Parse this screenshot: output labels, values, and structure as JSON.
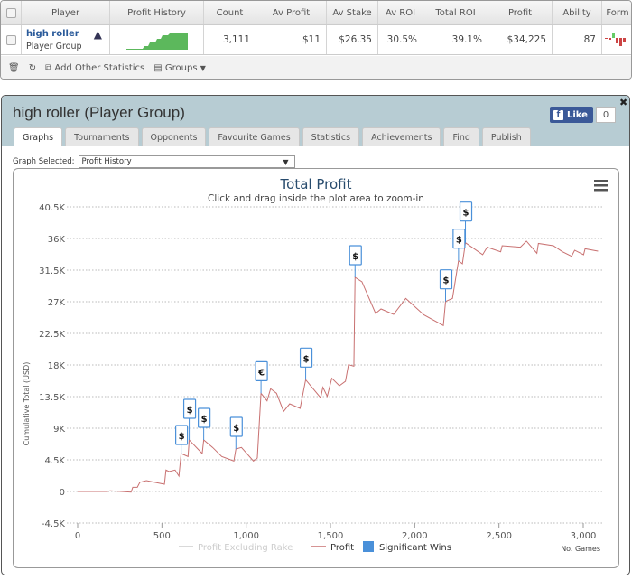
{
  "table": {
    "headers": [
      "Player",
      "Profit History",
      "Count",
      "Av Profit",
      "Av Stake",
      "Av ROI",
      "Total ROI",
      "Profit",
      "Ability",
      "Form"
    ],
    "row": {
      "player_name": "high roller",
      "player_type": "Player Group",
      "count": "3,111",
      "av_profit": "$11",
      "av_stake": "$26.35",
      "av_roi": "30.5%",
      "total_roi": "39.1%",
      "profit": "$34,225",
      "ability": "87"
    },
    "footer": {
      "add_stats": "Add Other Statistics",
      "groups": "Groups"
    }
  },
  "modal": {
    "title": "high roller (Player Group)",
    "like_label": "Like",
    "like_count": "0",
    "tabs": [
      "Graphs",
      "Tournaments",
      "Opponents",
      "Favourite Games",
      "Statistics",
      "Achievements",
      "Find",
      "Publish"
    ],
    "active_tab": "Graphs",
    "graph_selected_label": "Graph Selected:",
    "graph_selected_value": "Profit History"
  },
  "chart_data": {
    "type": "line",
    "title": "Total Profit",
    "subtitle": "Click and drag inside the plot area to zoom-in",
    "xlabel": "No. Games",
    "ylabel": "Cumulative Total (USD)",
    "xlim": [
      0,
      3120
    ],
    "ylim": [
      -4500,
      40500
    ],
    "xticks": [
      0,
      500,
      1000,
      1500,
      2000,
      2500,
      3000
    ],
    "xtick_labels": [
      "0",
      "500",
      "1,000",
      "1,500",
      "2,000",
      "2,500",
      "3,000"
    ],
    "yticks": [
      -4500,
      0,
      4500,
      9000,
      13500,
      18000,
      22500,
      27000,
      31500,
      36000,
      40500
    ],
    "ytick_labels": [
      "-4.5K",
      "0",
      "4.5K",
      "9K",
      "13.5K",
      "18K",
      "22.5K",
      "27K",
      "31.5K",
      "36K",
      "40.5K"
    ],
    "grid": true,
    "legend": [
      {
        "name": "Profit Excluding Rake",
        "color": "#cccccc"
      },
      {
        "name": "Profit",
        "color": "#c0504d"
      },
      {
        "name": "Significant Wins",
        "color": "#4a90d9"
      }
    ],
    "legend_placement": "bottom",
    "series": [
      {
        "name": "Profit",
        "color": "#c87070",
        "points": [
          [
            0,
            0
          ],
          [
            175,
            0
          ],
          [
            193,
            100
          ],
          [
            317,
            -100
          ],
          [
            327,
            600
          ],
          [
            354,
            600
          ],
          [
            369,
            1300
          ],
          [
            408,
            1540
          ],
          [
            515,
            1030
          ],
          [
            524,
            3050
          ],
          [
            542,
            2830
          ],
          [
            578,
            3050
          ],
          [
            601,
            2190
          ],
          [
            614,
            5400
          ],
          [
            655,
            4970
          ],
          [
            662,
            7330
          ],
          [
            739,
            5400
          ],
          [
            748,
            7330
          ],
          [
            801,
            6260
          ],
          [
            855,
            4970
          ],
          [
            927,
            4330
          ],
          [
            939,
            6040
          ],
          [
            972,
            6260
          ],
          [
            1043,
            4330
          ],
          [
            1066,
            4760
          ],
          [
            1088,
            13970
          ],
          [
            1124,
            12900
          ],
          [
            1145,
            14620
          ],
          [
            1180,
            13970
          ],
          [
            1222,
            11400
          ],
          [
            1258,
            12470
          ],
          [
            1320,
            11830
          ],
          [
            1353,
            15900
          ],
          [
            1442,
            13330
          ],
          [
            1455,
            14830
          ],
          [
            1481,
            13540
          ],
          [
            1508,
            16110
          ],
          [
            1553,
            15040
          ],
          [
            1589,
            15680
          ],
          [
            1607,
            18040
          ],
          [
            1639,
            17830
          ],
          [
            1646,
            30470
          ],
          [
            1687,
            29830
          ],
          [
            1768,
            25330
          ],
          [
            1800,
            25970
          ],
          [
            1875,
            25200
          ],
          [
            1947,
            27470
          ],
          [
            2054,
            25140
          ],
          [
            2170,
            23620
          ],
          [
            2183,
            27040
          ],
          [
            2224,
            27470
          ],
          [
            2242,
            30170
          ],
          [
            2260,
            32830
          ],
          [
            2283,
            32400
          ],
          [
            2301,
            35400
          ],
          [
            2403,
            33690
          ],
          [
            2430,
            34760
          ],
          [
            2510,
            34110
          ],
          [
            2519,
            34970
          ],
          [
            2627,
            34760
          ],
          [
            2663,
            35620
          ],
          [
            2725,
            33900
          ],
          [
            2734,
            35300
          ],
          [
            2823,
            34970
          ],
          [
            2877,
            34110
          ],
          [
            2931,
            33470
          ],
          [
            2949,
            34330
          ],
          [
            3002,
            33690
          ],
          [
            3011,
            34540
          ],
          [
            3088,
            34200
          ]
        ]
      }
    ],
    "significant_wins": [
      {
        "x": 614,
        "y": 5400,
        "symbol": "$"
      },
      {
        "x": 662,
        "y": 7330,
        "symbol": "$"
      },
      {
        "x": 748,
        "y": 7330,
        "symbol": "$"
      },
      {
        "x": 939,
        "y": 6040,
        "symbol": "$"
      },
      {
        "x": 1088,
        "y": 13970,
        "symbol": "€"
      },
      {
        "x": 1353,
        "y": 15900,
        "symbol": "$"
      },
      {
        "x": 1646,
        "y": 30470,
        "symbol": "$"
      },
      {
        "x": 2183,
        "y": 27040,
        "symbol": "$"
      },
      {
        "x": 2260,
        "y": 32830,
        "symbol": "$"
      },
      {
        "x": 2301,
        "y": 35400,
        "symbol": "$"
      }
    ]
  }
}
